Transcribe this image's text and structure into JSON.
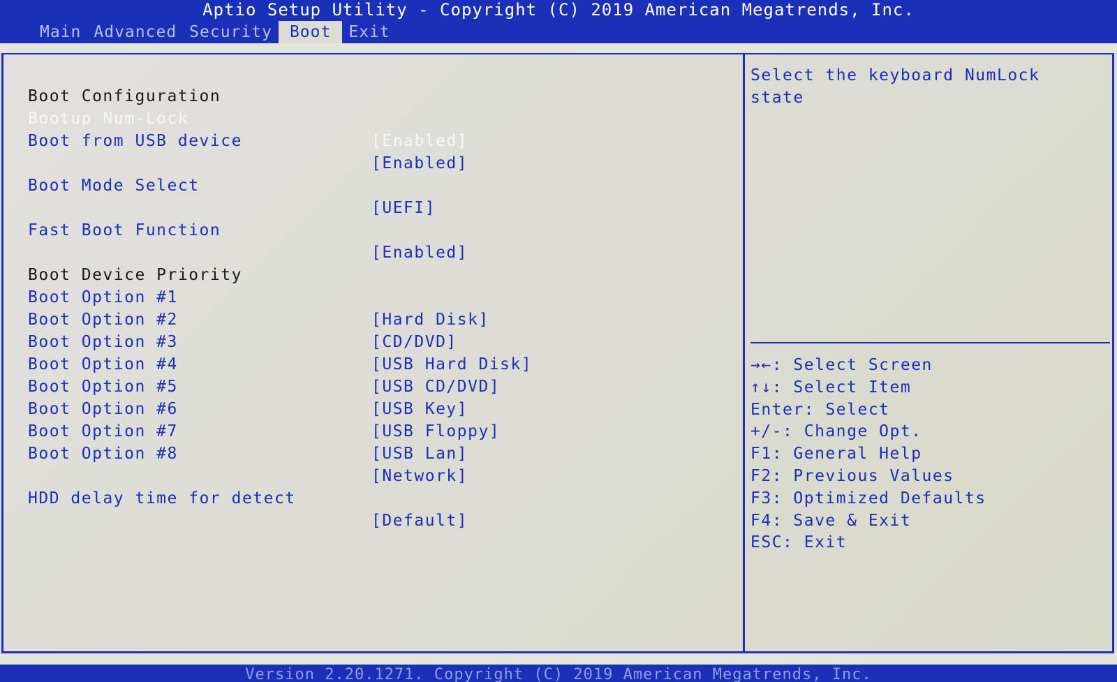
{
  "header": {
    "title": "Aptio Setup Utility - Copyright (C) 2019 American Megatrends, Inc.",
    "tabs": [
      {
        "label": "Main",
        "active": false
      },
      {
        "label": "Advanced",
        "active": false
      },
      {
        "label": "Security",
        "active": false
      },
      {
        "label": "Boot",
        "active": true
      },
      {
        "label": "Exit",
        "active": false
      }
    ]
  },
  "main": {
    "section_boot_config": "Boot Configuration",
    "items": [
      {
        "label": "Bootup Num-Lock",
        "value": "[Enabled]",
        "selected": true
      },
      {
        "label": "Boot from USB device",
        "value": "[Enabled]"
      },
      {
        "label": "Boot Mode Select",
        "value": "[UEFI]"
      },
      {
        "label": "Fast Boot Function",
        "value": "[Enabled]"
      }
    ],
    "section_boot_priority": "Boot Device Priority",
    "boot_options": [
      {
        "label": "Boot Option #1",
        "value": "[Hard Disk]"
      },
      {
        "label": "Boot Option #2",
        "value": "[CD/DVD]"
      },
      {
        "label": "Boot Option #3",
        "value": "[USB Hard Disk]"
      },
      {
        "label": "Boot Option #4",
        "value": "[USB CD/DVD]"
      },
      {
        "label": "Boot Option #5",
        "value": "[USB Key]"
      },
      {
        "label": "Boot Option #6",
        "value": "[USB Floppy]"
      },
      {
        "label": "Boot Option #7",
        "value": "[USB Lan]"
      },
      {
        "label": "Boot Option #8",
        "value": "[Network]"
      }
    ],
    "hdd_delay": {
      "label": "HDD delay time for detect",
      "value": "[Default]"
    }
  },
  "help": {
    "description": "Select the keyboard NumLock state",
    "keys": [
      "→←: Select Screen",
      "↑↓: Select Item",
      "Enter: Select",
      "+/-: Change Opt.",
      "F1: General Help",
      "F2: Previous Values",
      "F3: Optimized Defaults",
      "F4: Save & Exit",
      "ESC: Exit"
    ]
  },
  "footer": {
    "text": "Version 2.20.1271. Copyright (C) 2019 American Megatrends, Inc."
  }
}
